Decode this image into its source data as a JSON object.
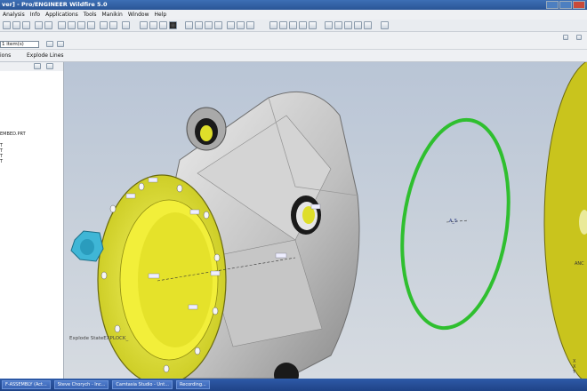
{
  "window": {
    "title": "ver] - Pro/ENGINEER Wildfire 5.0"
  },
  "menu": [
    "Analysis",
    "Info",
    "Applications",
    "Tools",
    "Manikin",
    "Window",
    "Help"
  ],
  "toolbar2": {
    "filter_value": "1 item(s)"
  },
  "tabs": {
    "left": "ions",
    "explode_lines": "Explode Lines"
  },
  "model_tree": {
    "items": [
      "EMBED.PRT",
      "T",
      "T",
      "T",
      "T"
    ]
  },
  "viewport": {
    "status_text": "Explode StateEXPLOCK_",
    "note_label": "A_5",
    "coords_label": "A_5",
    "triad_labels": [
      "X",
      "X",
      "Y",
      "ANC"
    ]
  },
  "taskbar": {
    "items": [
      "F-ASSEMBLY (Act...",
      "Steve Chorych - Inc...",
      "Camtasia Studio - Unt...",
      "Recording..."
    ]
  }
}
